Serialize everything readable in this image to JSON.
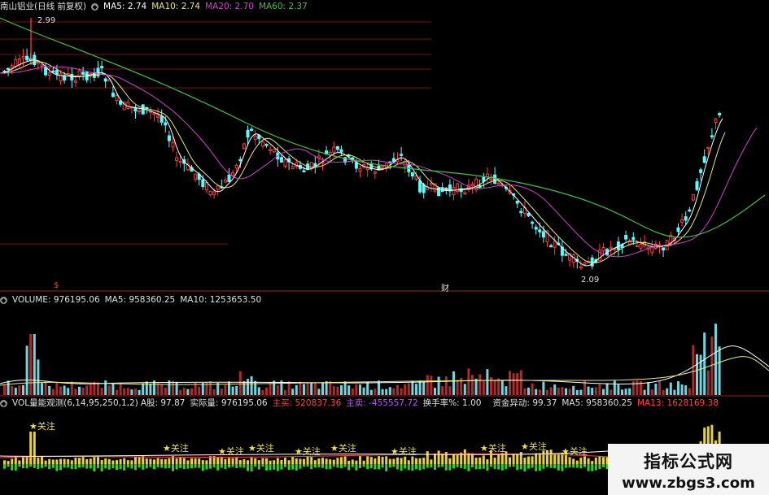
{
  "price_panel": {
    "title": "南山铝业(日线 前复权)",
    "ma5": "MA5: 2.74",
    "ma10": "MA10: 2.74",
    "ma20": "MA20: 2.70",
    "ma60": "MA60: 2.37",
    "high_label": "2.99",
    "low_label": "2.09",
    "marker_left": "$",
    "marker_right": "财"
  },
  "volume_panel": {
    "volume": "VOLUME: 976195.06",
    "ma5": "MA5: 958360.25",
    "ma10": "MA10: 1253653.50"
  },
  "vol_panel": {
    "name": "VOL量能观测(6,14,95,250,1,2)",
    "a_shares": "A股: 97.87",
    "actual": "实际量: 976195.06",
    "main_buy": "主买: 520837.36",
    "main_sell": "主卖: -455557.72",
    "turnover": "换手率%: 1.00",
    "fund": "资金异动: 99.37",
    "ma5": "MA5: 958360.25",
    "ma13": "MA13: 1628169.38",
    "attention_label": "关注"
  },
  "watermark": {
    "title": "指标公式网",
    "url": "www.zbgs3.com"
  },
  "colors": {
    "up": "#ff3b3b",
    "down": "#54ffff",
    "ma5": "#ffffff",
    "ma10": "#e8e87a",
    "ma20": "#d040d0",
    "ma60": "#40c040",
    "grid": "#7a1010",
    "yellow_bar": "#e8d23a",
    "green_bar": "#29d829"
  }
}
